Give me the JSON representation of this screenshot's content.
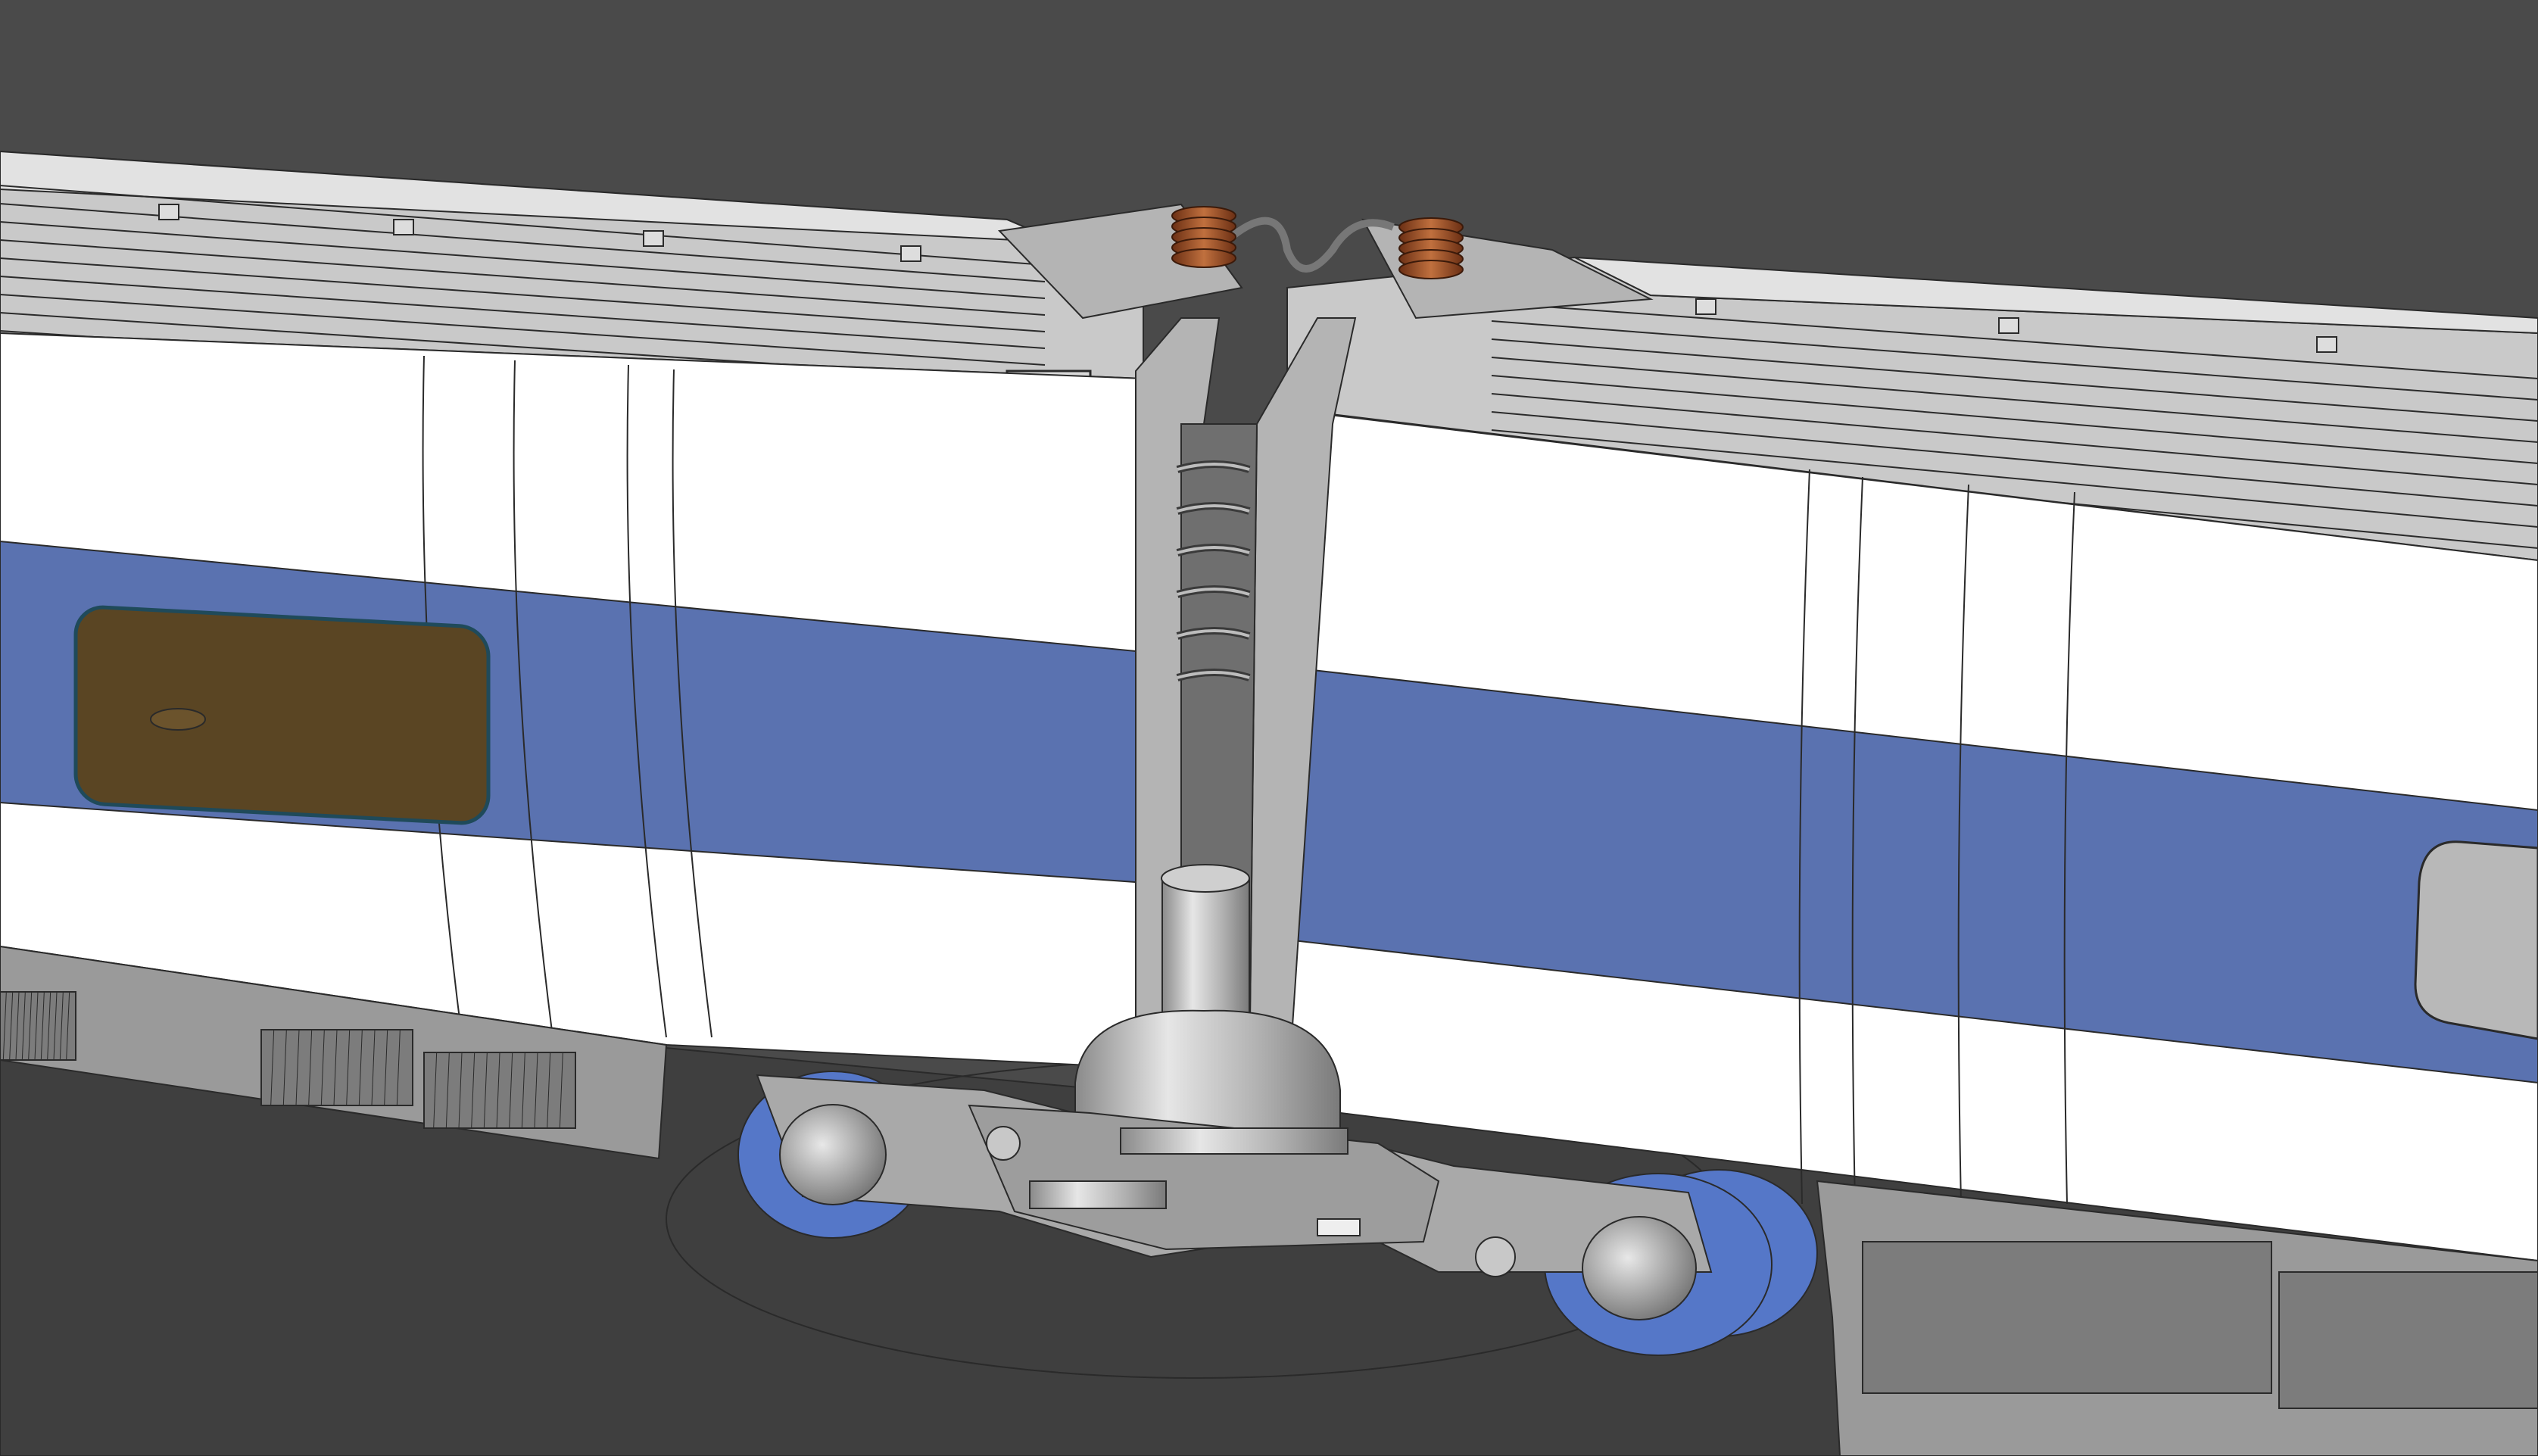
{
  "viewport": {
    "background_color": "#4a4a4a",
    "floor_color": "#3f3f3f",
    "object": "articulated-rail-cars"
  },
  "colors": {
    "body_white": "#ffffff",
    "stripe_blue": "#5a72b0",
    "roof_grey": "#c9c9c9",
    "roof_light": "#e2e2e2",
    "skirt_grey": "#9a9a9a",
    "skirt_dark": "#7c7c7c",
    "coupler_grey": "#b4b4b4",
    "wheel_blue": "#5577c8",
    "window_brown": "#5a4523",
    "window_grey": "#b8b8b8",
    "spring_copper": "#a0522d",
    "edge_line": "#2a2a2a"
  },
  "icons": [
    "pantograph-coil-icon",
    "bolt-icon"
  ]
}
